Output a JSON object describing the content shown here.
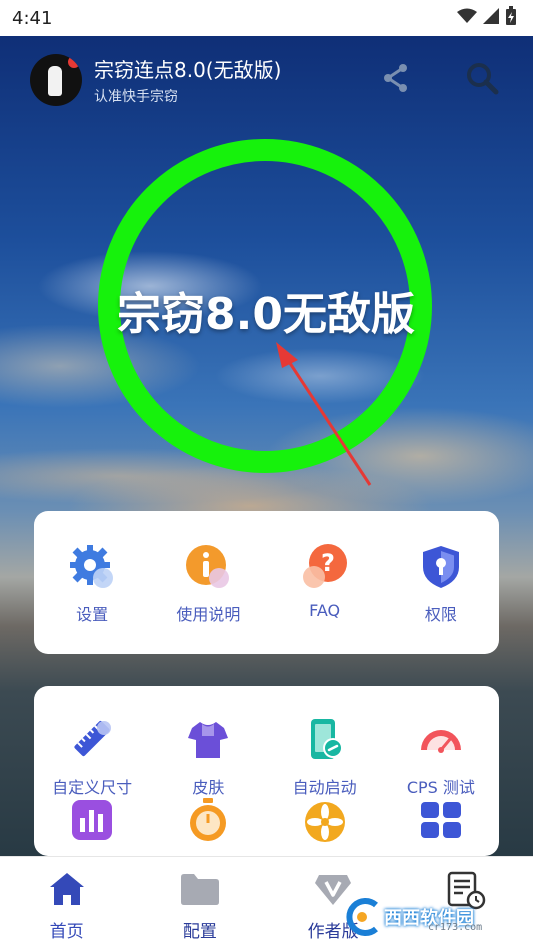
{
  "status_bar": {
    "time": "4:41"
  },
  "header": {
    "title": "宗窃连点8.0(无敌版)",
    "subtitle": "认准快手宗窃"
  },
  "hero": {
    "ring_text": "宗窃8.0无敌版",
    "ring_color": "#16f20c"
  },
  "quick_actions": [
    {
      "label": "设置",
      "icon": "gear-icon"
    },
    {
      "label": "使用说明",
      "icon": "info-icon"
    },
    {
      "label": "FAQ",
      "icon": "question-icon"
    },
    {
      "label": "权限",
      "icon": "shield-lock-icon"
    }
  ],
  "tools": [
    {
      "label": "自定义尺寸",
      "icon": "ruler-icon"
    },
    {
      "label": "皮肤",
      "icon": "shirt-icon"
    },
    {
      "label": "自动启动",
      "icon": "phone-link-icon"
    },
    {
      "label": "CPS 测试",
      "icon": "speedometer-icon"
    }
  ],
  "tools_row2": [
    {
      "icon": "bar-chart-icon"
    },
    {
      "icon": "stopwatch-icon"
    },
    {
      "icon": "fan-icon"
    },
    {
      "icon": "grid-icon"
    }
  ],
  "bottom_nav": [
    {
      "label": "首页",
      "icon": "home-icon",
      "active": true
    },
    {
      "label": "配置",
      "icon": "folder-icon",
      "active": false
    },
    {
      "label": "作者版",
      "icon": "vip-icon",
      "active": false
    },
    {
      "label": "",
      "icon": "log-icon",
      "active": false
    }
  ],
  "watermark": {
    "text": "西西软件园",
    "url": "cr173.com"
  },
  "colors": {
    "accent": "#3449b8",
    "label": "#4a5dbd",
    "ring": "#16f20c"
  }
}
